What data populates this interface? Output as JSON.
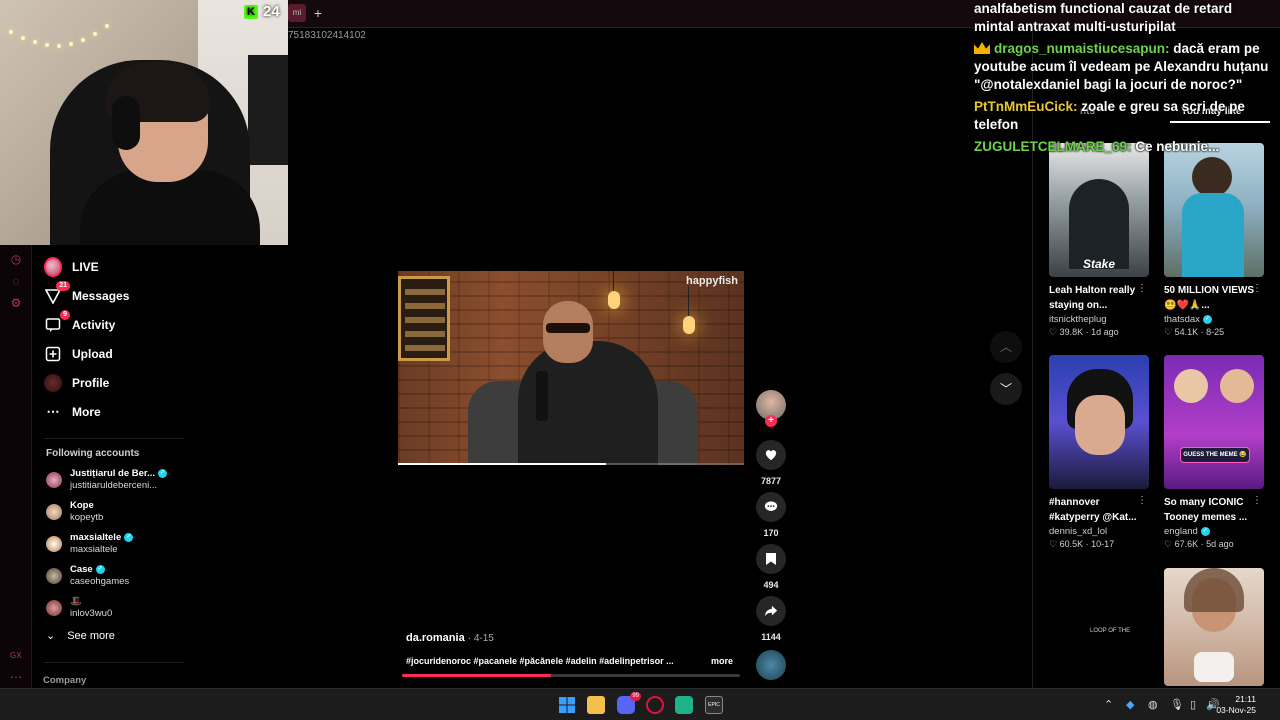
{
  "browser": {
    "url_fragment": "75183102414102",
    "tab_stub": "mi"
  },
  "stream": {
    "viewer_count": "24",
    "platform_icon": "kick-logo"
  },
  "nav": {
    "items": [
      {
        "label": "LIVE",
        "icon": "live-avatar"
      },
      {
        "label": "Messages",
        "icon": "send-icon",
        "badge": "21"
      },
      {
        "label": "Activity",
        "icon": "message-icon",
        "badge": "9"
      },
      {
        "label": "Upload",
        "icon": "upload-icon"
      },
      {
        "label": "Profile",
        "icon": "profile-avatar"
      },
      {
        "label": "More",
        "icon": "more-icon"
      }
    ],
    "following_title": "Following accounts",
    "accounts": [
      {
        "name": "Justițiarul de Ber...",
        "handle": "justitiaruldeberceni...",
        "verified": true
      },
      {
        "name": "Kope",
        "handle": "kopeytb",
        "verified": false
      },
      {
        "name": "maxsialtele",
        "handle": "maxsialtele",
        "verified": true
      },
      {
        "name": "Case",
        "handle": "caseohgames",
        "verified": true
      },
      {
        "name": "🎩",
        "handle": "inlov3wu0",
        "verified": false
      }
    ],
    "see_more": "See more",
    "company": "Company",
    "gx_label": "GX"
  },
  "video": {
    "brand_watermark": "happyfish",
    "author": "da.romania",
    "date": "· 4-15",
    "hashtags": "#jocuridenoroc #pacanele #păcănele #adelin #adelinpetrisor ...",
    "more": "more",
    "progress_fraction": 0.44,
    "frame_progress_fraction": 0.6,
    "likes": "7877",
    "comments": "170",
    "saves": "494",
    "shares": "1144"
  },
  "chat": [
    {
      "user": "",
      "text": "analfabetism functional cauzat de retard mintal antraxat multi-usturipilat",
      "user_color": "#ffffff"
    },
    {
      "user": "dragos_numaistiucesapun:",
      "text": " dacă eram pe youtube acum îl vedeam pe Alexandru huțanu \"@notalexdaniel bagi la jocuri de noroc?\"",
      "user_color": "#6ed24a",
      "crown": true
    },
    {
      "user": "PtTnMmEuCick:",
      "text": " zoale e greu sa scri de pe telefon",
      "user_color": "#e6c937"
    },
    {
      "user": "ZUGULETCELMARE_69:",
      "text": " Ce nebunie...",
      "user_color": "#6ed24a"
    }
  ],
  "right_panel": {
    "tabs": [
      "Comments",
      "You may like"
    ],
    "tab_hidden_fragment": "nts",
    "cards": [
      {
        "title": "Leah Halton really staying on...",
        "author": "itsnicktheplug",
        "verified": false,
        "likes": "39.8K",
        "age": "1d ago",
        "overlay": "Stake"
      },
      {
        "title": "50 MILLION VIEWS😵‍💫❤️🙏...",
        "author": "thatsdax",
        "verified": true,
        "likes": "54.1K",
        "age": "8-25",
        "overlay": ""
      },
      {
        "title": "#hannover #katyperry @Kat...",
        "author": "dennis_xd_lol",
        "verified": false,
        "likes": "60.5K",
        "age": "10-17",
        "overlay": ""
      },
      {
        "title": "So many ICONIC Tooney memes ...",
        "author": "england",
        "verified": true,
        "likes": "67.6K",
        "age": "5d ago",
        "overlay": "GUESS THE MEME 😂"
      },
      {
        "title": "",
        "author": "",
        "verified": false,
        "likes": "",
        "age": "",
        "overlay": ""
      }
    ],
    "loop_mark": "LOOP OF THE"
  },
  "taskbar": {
    "time": "21:11",
    "date": "03-Nov-25",
    "discord_badge": "99",
    "apps": [
      "windows-start-icon",
      "file-explorer-icon",
      "discord-icon",
      "opera-gx-icon",
      "spotify-like-icon",
      "epic-games-icon"
    ]
  },
  "colors": {
    "accent": "#fe2c55",
    "verified": "#20d5ec",
    "kick_green": "#53fc18",
    "opera_red": "#b23a56"
  }
}
